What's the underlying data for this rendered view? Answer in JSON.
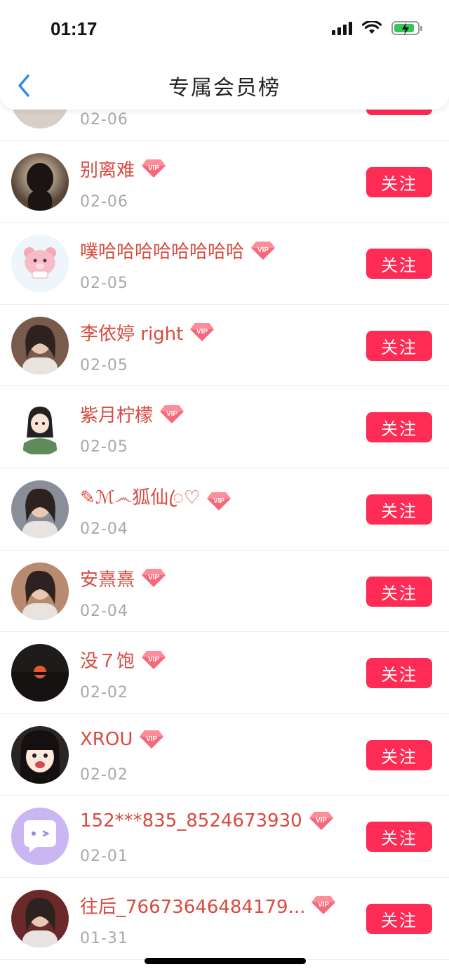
{
  "status_bar": {
    "time": "01:17",
    "battery_color": "#35c759"
  },
  "nav": {
    "title": "专属会员榜",
    "accent": "#2f8fe8"
  },
  "follow_color": "#fe2b54",
  "name_color": "#d84a3f",
  "members": [
    {
      "name": "",
      "date": "02-06",
      "vip": false,
      "follow_label": "关注",
      "avatar_icon": "photo-avatar-partial",
      "avatar_bg": "#d9cfc8"
    },
    {
      "name": "别离难",
      "date": "02-06",
      "vip": true,
      "follow_label": "关注",
      "avatar_icon": "silhouette-avatar",
      "avatar_bg": "#3b2f2a"
    },
    {
      "name": "噗哈哈哈哈哈哈哈哈",
      "date": "02-05",
      "vip": true,
      "follow_label": "关注",
      "avatar_icon": "pink-bear-avatar",
      "avatar_bg": "#eef6fb"
    },
    {
      "name": "李依婷 right",
      "date": "02-05",
      "vip": true,
      "follow_label": "关注",
      "avatar_icon": "photo-avatar",
      "avatar_bg": "#7a5a4c"
    },
    {
      "name": "紫月柠檬",
      "date": "02-05",
      "vip": true,
      "follow_label": "关注",
      "avatar_icon": "cartoon-girl-avatar",
      "avatar_bg": "#ffffff"
    },
    {
      "name": "✎ℳ෴狐仙ꦿ♡",
      "date": "02-04",
      "vip": true,
      "follow_label": "关注",
      "avatar_icon": "photo-avatar",
      "avatar_bg": "#8a8e99"
    },
    {
      "name": "安熹熹",
      "date": "02-04",
      "vip": true,
      "follow_label": "关注",
      "avatar_icon": "photo-avatar",
      "avatar_bg": "#b88a70"
    },
    {
      "name": "没７饱",
      "date": "02-02",
      "vip": true,
      "follow_label": "关注",
      "avatar_icon": "sunset-avatar",
      "avatar_bg": "#1f1b1a"
    },
    {
      "name": "XROU",
      "date": "02-02",
      "vip": true,
      "follow_label": "关注",
      "avatar_icon": "anime-girl-avatar",
      "avatar_bg": "#2a2426"
    },
    {
      "name": "152***835_8524673930",
      "date": "02-01",
      "vip": true,
      "follow_label": "关注",
      "avatar_icon": "chat-bubble-avatar",
      "avatar_bg": "#c9b6f2"
    },
    {
      "name": "往后_76673646484179...",
      "date": "01-31",
      "vip": true,
      "follow_label": "关注",
      "avatar_icon": "photo-avatar",
      "avatar_bg": "#6b2a2a"
    }
  ]
}
